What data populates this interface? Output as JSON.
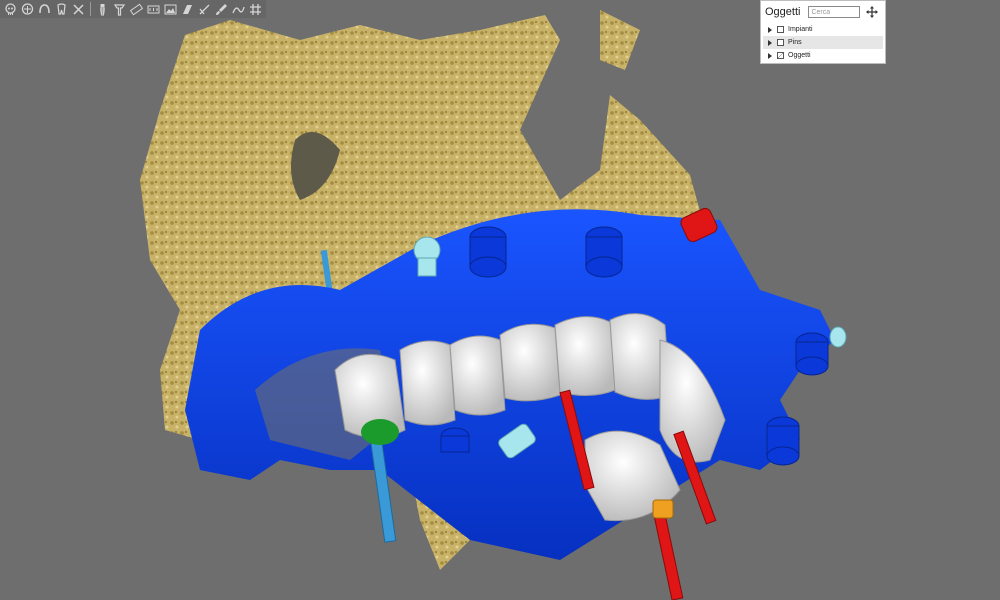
{
  "toolbar": {
    "tools": [
      {
        "icon": "skull-icon"
      },
      {
        "icon": "skull-front-icon"
      },
      {
        "icon": "dental-arch-icon"
      },
      {
        "icon": "tooth-icon"
      },
      {
        "icon": "close-icon"
      },
      {
        "icon": "implant-icon"
      },
      {
        "icon": "abutment-icon"
      },
      {
        "icon": "ruler-icon"
      },
      {
        "icon": "panoramic-icon"
      },
      {
        "icon": "image-icon"
      },
      {
        "icon": "cut-plane-icon"
      },
      {
        "icon": "draw-line-icon"
      },
      {
        "icon": "brush-icon"
      },
      {
        "icon": "curve-icon"
      },
      {
        "icon": "grid-icon"
      }
    ]
  },
  "panel": {
    "title": "Oggetti",
    "search_placeholder": "Cerca",
    "items": [
      {
        "label": "Impianti",
        "checked": false
      },
      {
        "label": "Pins",
        "checked": false
      },
      {
        "label": "Oggetti",
        "checked": "partial"
      }
    ]
  },
  "colors": {
    "background": "#6e6e6e",
    "bone": "#c9b46a",
    "surgical_guide": "#0a3ee8",
    "teeth": "#ebebeb",
    "pins": "#e01515",
    "implants": "#3a9ad8",
    "panel_bg": "#ffffff"
  }
}
